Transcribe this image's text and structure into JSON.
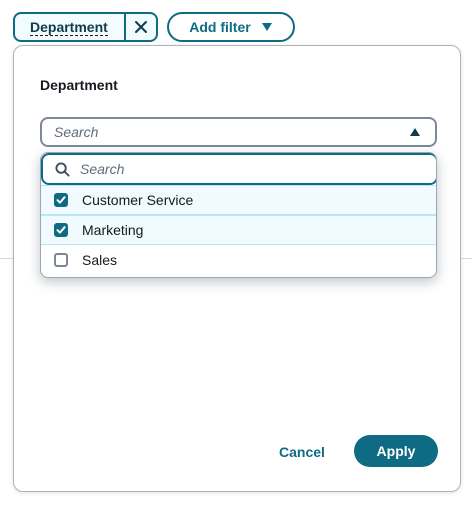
{
  "filter_bar": {
    "active_chip_label": "Department",
    "add_filter_label": "Add filter"
  },
  "popover": {
    "title": "Department",
    "select_placeholder": "Search",
    "search_placeholder": "Search",
    "options": [
      {
        "label": "Customer Service",
        "checked": true
      },
      {
        "label": "Marketing",
        "checked": true
      },
      {
        "label": "Sales",
        "checked": false
      }
    ],
    "cancel_label": "Cancel",
    "apply_label": "Apply"
  },
  "colors": {
    "accent": "#0f6b84",
    "selected_row_bg": "#f1faff",
    "text": "#16191f",
    "border": "#aab7b8"
  },
  "icons": [
    "close-icon",
    "caret-down-icon",
    "caret-up-icon",
    "search-icon",
    "checkmark-icon"
  ]
}
